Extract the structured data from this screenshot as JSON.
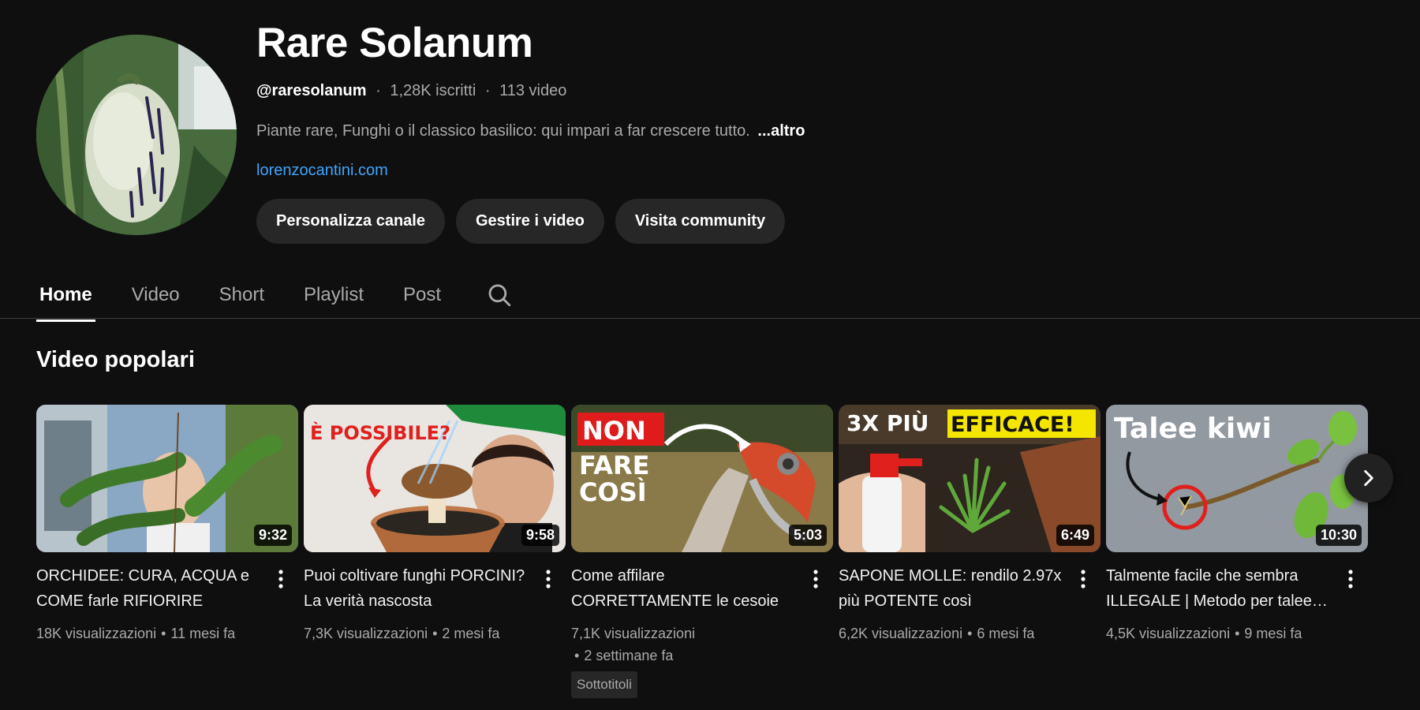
{
  "channel": {
    "name": "Rare Solanum",
    "handle": "@raresolanum",
    "subscribers": "1,28K iscritti",
    "video_count": "113 video",
    "meta_separator": "·",
    "description": "Piante rare, Funghi o il classico basilico: qui impari a far crescere tutto.",
    "more_label": "...altro",
    "link": "lorenzocantini.com"
  },
  "actions": {
    "customize": "Personalizza canale",
    "manage": "Gestire i video",
    "community": "Visita community"
  },
  "tabs": [
    {
      "label": "Home",
      "active": true
    },
    {
      "label": "Video",
      "active": false
    },
    {
      "label": "Short",
      "active": false
    },
    {
      "label": "Playlist",
      "active": false
    },
    {
      "label": "Post",
      "active": false
    }
  ],
  "section": {
    "title": "Video popolari"
  },
  "videos": [
    {
      "title": "ORCHIDEE: CURA, ACQUA e COME farle RIFIORIRE",
      "duration": "9:32",
      "views": "18K visualizzazioni",
      "age": "11 mesi fa",
      "separator": "•"
    },
    {
      "title": "Puoi coltivare funghi PORCINI? La verità nascosta",
      "duration": "9:58",
      "views": "7,3K visualizzazioni",
      "age": "2 mesi fa",
      "separator": "•",
      "thumb_text": "È POSSIBILE?"
    },
    {
      "title": "Come affilare CORRETTAMENTE le cesoie",
      "duration": "5:03",
      "views": "7,1K visualizzazioni",
      "age": "2 settimane fa",
      "separator": "•",
      "badge": "Sottotitoli",
      "thumb_text_1": "NON",
      "thumb_text_2": "FARE",
      "thumb_text_3": "COSÌ"
    },
    {
      "title": "SAPONE MOLLE: rendilo 2.97x più POTENTE così",
      "duration": "6:49",
      "views": "6,2K visualizzazioni",
      "age": "6 mesi fa",
      "separator": "•",
      "thumb_text_1": "3X PIÙ",
      "thumb_text_2": "EFFICACE!"
    },
    {
      "title": "Talmente facile che sembra ILLEGALE | Metodo per talee kiwi",
      "duration": "10:30",
      "views": "4,5K visualizzazioni",
      "age": "9 mesi fa",
      "separator": "•",
      "thumb_text": "Talee kiwi"
    }
  ],
  "colors": {
    "background": "#0f0f0f",
    "link": "#3ea6ff",
    "button_bg": "#272727"
  },
  "icons": {
    "search": "search-icon",
    "more": "more-vert-icon",
    "next": "chevron-right-icon"
  }
}
